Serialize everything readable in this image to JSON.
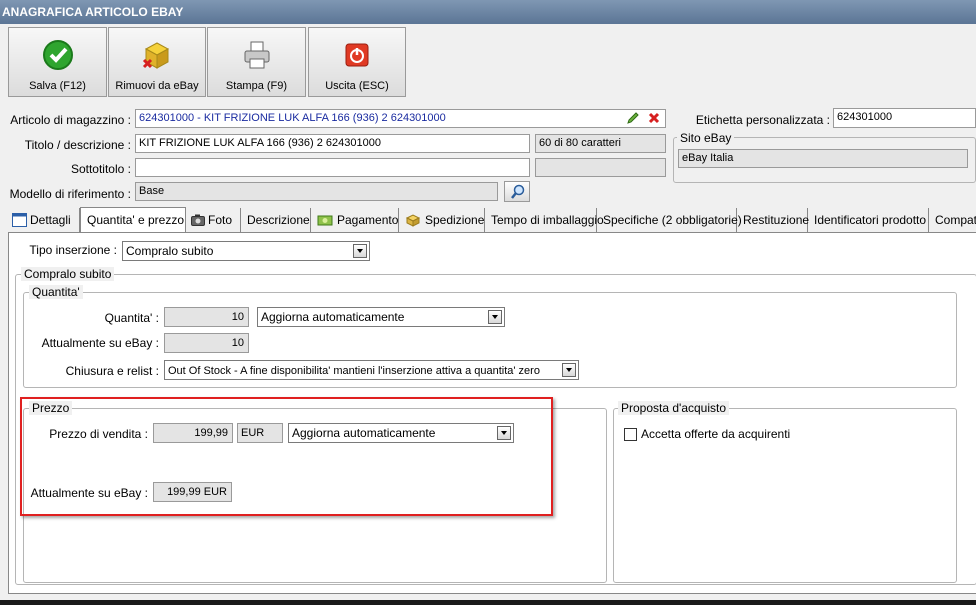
{
  "window": {
    "title": "ANAGRAFICA ARTICOLO EBAY"
  },
  "toolbar": {
    "save_label": "Salva (F12)",
    "remove_label": "Rimuovi da eBay",
    "print_label": "Stampa (F9)",
    "exit_label": "Uscita (ESC)"
  },
  "form": {
    "article_label": "Articolo di magazzino :",
    "article_value": "624301000 - KIT FRIZIONE LUK  ALFA 166 (936) 2                    624301000",
    "custom_label_label": "Etichetta personalizzata :",
    "custom_label_value": "624301000",
    "title_label": "Titolo / descrizione :",
    "title_value": "KIT FRIZIONE LUK  ALFA 166 (936) 2                  624301000",
    "char_count": "60 di 80 caratteri",
    "subtitle_label": "Sottotitolo :",
    "subtitle_value": "",
    "model_label": "Modello di riferimento :",
    "model_value": "Base",
    "site_group": "Sito eBay",
    "site_value": "eBay Italia"
  },
  "tabs": [
    {
      "label": "Dettagli"
    },
    {
      "label": "Quantita' e prezzo"
    },
    {
      "label": "Foto"
    },
    {
      "label": "Descrizione"
    },
    {
      "label": "Pagamento"
    },
    {
      "label": "Spedizione"
    },
    {
      "label": "Tempo di imballaggio"
    },
    {
      "label": "Specifiche (2 obbligatorie)"
    },
    {
      "label": "Restituzione"
    },
    {
      "label": "Identificatori prodotto"
    },
    {
      "label": "Compatib"
    }
  ],
  "panel": {
    "listing_type_label": "Tipo inserzione :",
    "listing_type_value": "Compralo subito",
    "buy_now_group": "Compralo subito",
    "qty_group": "Quantita'",
    "qty_label": "Quantita' :",
    "qty_value": "10",
    "qty_update": "Aggiorna automaticamente",
    "qty_ebay_label": "Attualmente su eBay :",
    "qty_ebay_value": "10",
    "close_label": "Chiusura e relist :",
    "close_value": "Out Of Stock - A fine disponibilita' mantieni l'inserzione attiva a quantita' zero",
    "price_group": "Prezzo",
    "price_label": "Prezzo di vendita :",
    "price_value": "199,99",
    "currency": "EUR",
    "price_update": "Aggiorna automaticamente",
    "price_ebay_label": "Attualmente su eBay :",
    "price_ebay_value": "199,99 EUR",
    "offer_group": "Proposta d'acquisto",
    "offer_checkbox": "Accetta offerte da acquirenti"
  },
  "colors": {
    "highlight": "#e02020",
    "link_blue": "#1a2ba0",
    "titlebar": "#6a84a4"
  }
}
